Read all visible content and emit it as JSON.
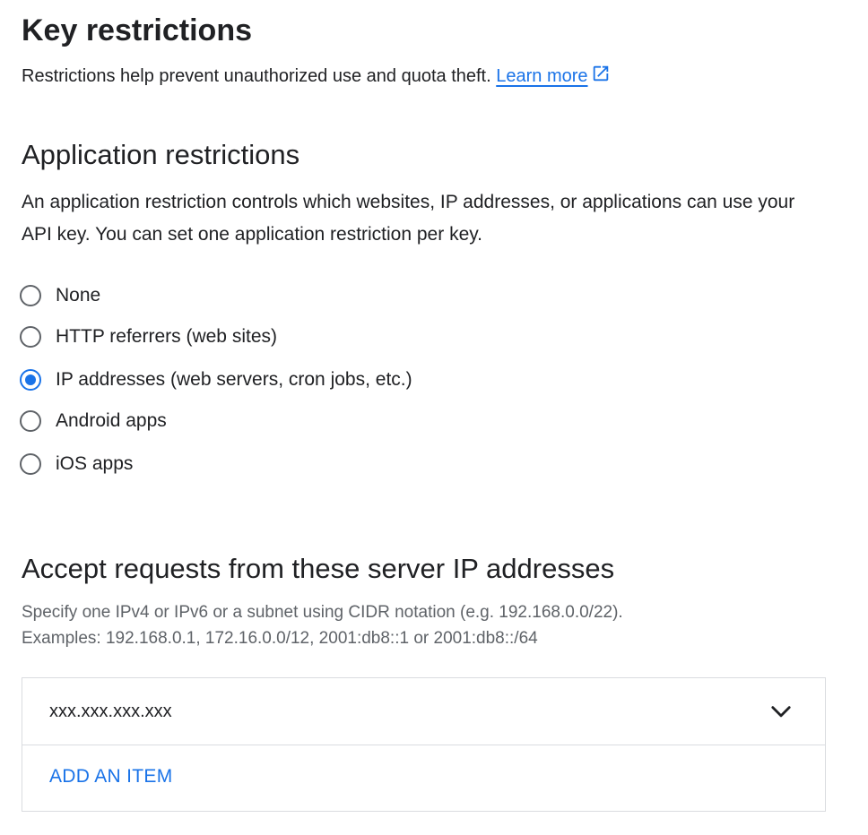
{
  "key_restrictions": {
    "title": "Key restrictions",
    "description": "Restrictions help prevent unauthorized use and quota theft.",
    "learn_more": "Learn more"
  },
  "application_restrictions": {
    "title": "Application restrictions",
    "description": "An application restriction controls which websites, IP addresses, or applications can use your API key. You can set one application restriction per key.",
    "options": [
      {
        "label": "None",
        "checked": false
      },
      {
        "label": "HTTP referrers (web sites)",
        "checked": false
      },
      {
        "label": "IP addresses (web servers, cron jobs, etc.)",
        "checked": true
      },
      {
        "label": "Android apps",
        "checked": false
      },
      {
        "label": "iOS apps",
        "checked": false
      }
    ]
  },
  "ip_section": {
    "title": "Accept requests from these server IP addresses",
    "hint_line1": "Specify one IPv4 or IPv6 or a subnet using CIDR notation (e.g. 192.168.0.0/22).",
    "hint_line2": "Examples: 192.168.0.1, 172.16.0.0/12, 2001:db8::1 or 2001:db8::/64",
    "items": [
      "xxx.xxx.xxx.xxx"
    ],
    "add_item_label": "ADD AN ITEM"
  },
  "icons": {
    "external_link": "open-in-new-icon",
    "expand": "chevron-down-icon"
  },
  "colors": {
    "accent": "#1a73e8",
    "text": "#202124",
    "secondary_text": "#5f6368",
    "border": "#dadce0"
  }
}
